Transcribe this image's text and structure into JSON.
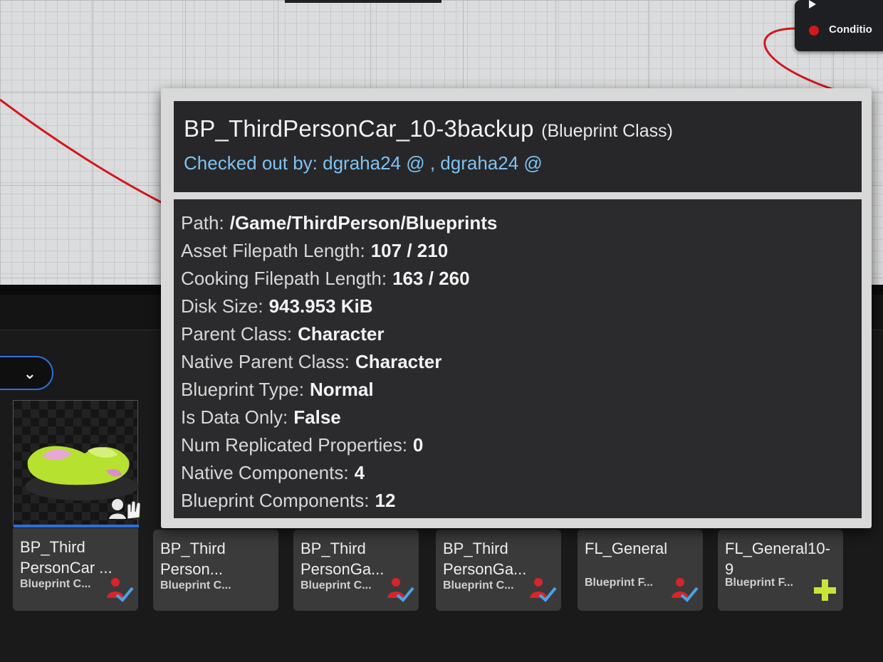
{
  "graph": {
    "node_pin_label": "Conditio",
    "wire_color": "#d2171c"
  },
  "tooltip": {
    "title": "BP_ThirdPersonCar_10-3backup",
    "kind": "(Blueprint Class)",
    "checked_out": "Checked out by: dgraha24 @ , dgraha24 @",
    "rows": [
      {
        "label": "Path:",
        "value": "/Game/ThirdPerson/Blueprints"
      },
      {
        "label": "Asset Filepath Length:",
        "value": "107 / 210"
      },
      {
        "label": "Cooking Filepath Length:",
        "value": "163 / 260"
      },
      {
        "label": "Disk Size:",
        "value": "943.953 KiB"
      },
      {
        "label": "Parent Class:",
        "value": "Character"
      },
      {
        "label": "Native Parent Class:",
        "value": "Character"
      },
      {
        "label": "Blueprint Type:",
        "value": "Normal"
      },
      {
        "label": "Is Data Only:",
        "value": "False"
      },
      {
        "label": "Num Replicated Properties:",
        "value": "0"
      },
      {
        "label": "Native Components:",
        "value": "4"
      },
      {
        "label": "Blueprint Components:",
        "value": "12"
      }
    ]
  },
  "assets": [
    {
      "name": "BP_Third\nPersonCar ...",
      "type": "Blueprint C...",
      "status": "checked-out-icon",
      "thumb": true
    },
    {
      "name": "BP_Third\nPerson...",
      "type": "Blueprint C...",
      "status": "",
      "thumb": false
    },
    {
      "name": "BP_Third\nPersonGa...",
      "type": "Blueprint C...",
      "status": "checked-out-icon",
      "thumb": false
    },
    {
      "name": "BP_Third\nPersonGa...",
      "type": "Blueprint C...",
      "status": "checked-out-icon",
      "thumb": false
    },
    {
      "name": "FL_General",
      "type": "Blueprint F...",
      "status": "checked-out-icon",
      "thumb": false
    },
    {
      "name": "FL_General10-\n9",
      "type": "Blueprint F...",
      "status": "add-icon",
      "thumb": false
    }
  ],
  "colors": {
    "accent": "#2d6fe0",
    "checkout_text": "#7fc2f2",
    "status_red": "#d9232a",
    "status_blue": "#4aa3e8",
    "add_green": "#c8e63a"
  }
}
